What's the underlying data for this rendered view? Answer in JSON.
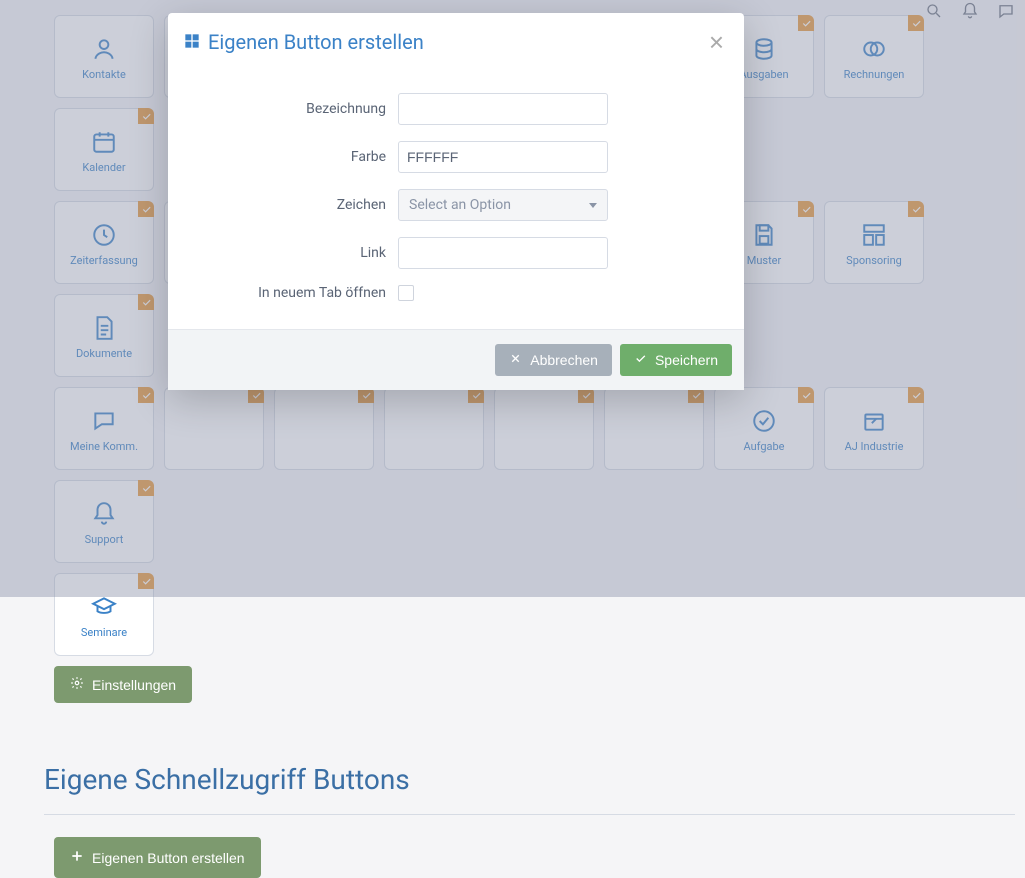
{
  "tiles": {
    "row1": [
      {
        "label": "Kontakte",
        "icon": "user",
        "check": false
      },
      {
        "label": "",
        "icon": "",
        "check": true
      },
      {
        "label": "",
        "icon": "",
        "check": true
      },
      {
        "label": "",
        "icon": "",
        "check": true
      },
      {
        "label": "",
        "icon": "",
        "check": true
      },
      {
        "label": "",
        "icon": "",
        "check": true
      },
      {
        "label": "Ausgaben",
        "icon": "coins",
        "check": true,
        "partial": true
      },
      {
        "label": "Rechnungen",
        "icon": "intersect",
        "check": true
      },
      {
        "label": "Kalender",
        "icon": "calendar",
        "check": true
      }
    ],
    "row2": [
      {
        "label": "Zeiterfassung",
        "icon": "clock",
        "check": true
      },
      {
        "label": "",
        "icon": "",
        "check": true
      },
      {
        "label": "",
        "icon": "",
        "check": true
      },
      {
        "label": "",
        "icon": "",
        "check": true
      },
      {
        "label": "",
        "icon": "",
        "check": true
      },
      {
        "label": "",
        "icon": "",
        "check": true
      },
      {
        "label": "Muster",
        "icon": "save",
        "check": true,
        "partial": true
      },
      {
        "label": "Sponsoring",
        "icon": "layout",
        "check": true
      },
      {
        "label": "Dokumente",
        "icon": "document",
        "check": true
      }
    ],
    "row3": [
      {
        "label": "Meine Komm.",
        "icon": "chat",
        "check": true
      },
      {
        "label": "",
        "icon": "",
        "check": true
      },
      {
        "label": "",
        "icon": "",
        "check": true
      },
      {
        "label": "",
        "icon": "",
        "check": true
      },
      {
        "label": "",
        "icon": "",
        "check": true
      },
      {
        "label": "",
        "icon": "",
        "check": true
      },
      {
        "label": "Aufgabe",
        "icon": "task",
        "check": true,
        "partial": true
      },
      {
        "label": "AJ Industrie",
        "icon": "box",
        "check": true
      },
      {
        "label": "Support",
        "icon": "bell",
        "check": true
      }
    ],
    "row4": [
      {
        "label": "Seminare",
        "icon": "grad",
        "check": true
      }
    ]
  },
  "settings_btn_label": "Einstellungen",
  "section_heading": "Eigene Schnellzugriff Buttons",
  "create_own_btn_label": "Eigenen Button erstellen",
  "modal": {
    "title": "Eigenen Button erstellen",
    "labels": {
      "name": "Bezeichnung",
      "color": "Farbe",
      "icon": "Zeichen",
      "link": "Link",
      "newtab": "In neuem Tab öffnen"
    },
    "values": {
      "name": "",
      "color": "FFFFFF",
      "icon_placeholder": "Select an Option",
      "link": ""
    },
    "buttons": {
      "cancel": "Abbrechen",
      "save": "Speichern"
    }
  }
}
